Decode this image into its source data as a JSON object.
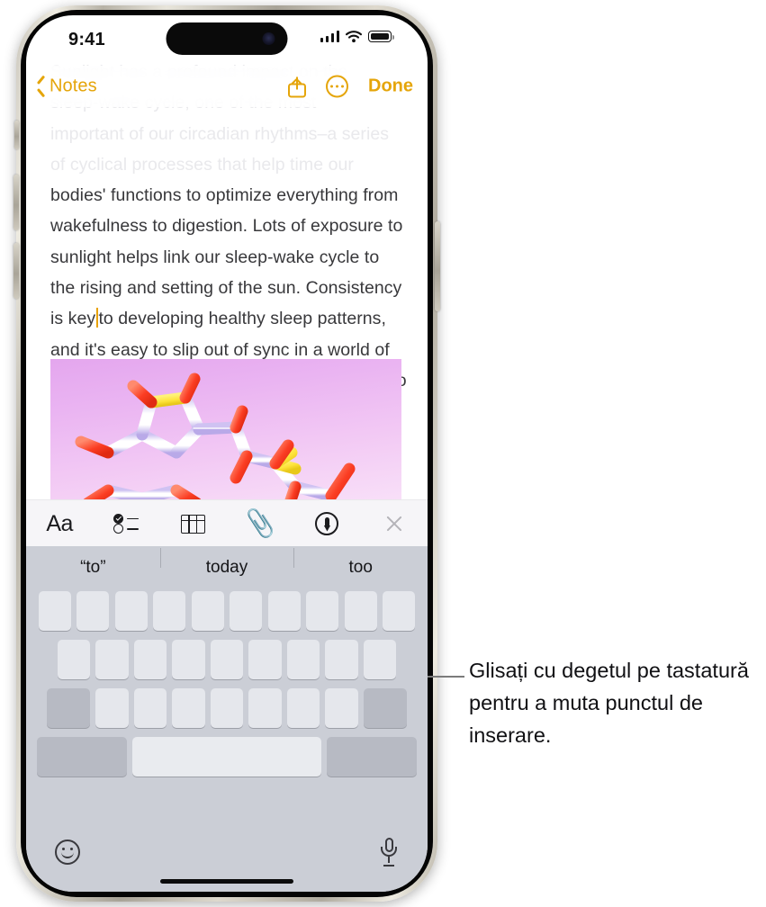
{
  "status_bar": {
    "time": "9:41",
    "signal_icon": "cellular-signal-icon",
    "wifi_icon": "wifi-icon",
    "battery_icon": "battery-icon"
  },
  "nav_bar": {
    "back_label": "Notes",
    "back_icon": "chevron-left-icon",
    "share_icon": "share-icon",
    "more_icon": "more-ellipsis-icon",
    "done_label": "Done"
  },
  "note": {
    "faded_lines": [
      "Sunlight has a profound impact on the",
      "sleep-wake cycle, one of the most",
      "important of our circadian rhythms–a series",
      "of cyclical processes that help time our"
    ],
    "visible_before_caret": "bodies' functions to optimize everything from wakefulness to digestion. Lots of exposure to sunlight helps link our sleep-wake cycle to the rising and setting of the sun. Consistency is key",
    "visible_after_caret": "to developing healthy sleep patterns, and it's easy to slip out of sync in a world of constant connection, where many are used to working across multiple timezones.",
    "attachment_name": "molecule-image-attachment"
  },
  "format_toolbar": {
    "items": [
      {
        "label": "Aa",
        "icon": "text-format-icon"
      },
      {
        "label": "",
        "icon": "checklist-icon"
      },
      {
        "label": "",
        "icon": "table-icon"
      },
      {
        "label": "",
        "icon": "paperclip-attachment-icon"
      },
      {
        "label": "",
        "icon": "markup-pen-icon"
      },
      {
        "label": "",
        "icon": "close-x-icon"
      }
    ]
  },
  "keyboard": {
    "predictions": [
      "“to”",
      "today",
      "too"
    ],
    "emoji_icon": "emoji-smiley-icon",
    "dictation_icon": "microphone-icon",
    "row1_keys": 10,
    "row2_keys": 9,
    "row3_keys": 9,
    "row4_fn_label": "",
    "row4_space_label": "",
    "row4_return_label": ""
  },
  "callout": {
    "text": "Glisați cu degetul pe tastatură pentru a muta punctul de inserare."
  },
  "colors": {
    "accent": "#E5A50A",
    "caret": "#E8A200",
    "keyboard_bg": "#CBCED6",
    "key_face": "#E5E7EC",
    "key_dark": "#B7BAC3",
    "toolbar_bg": "#F6F5F8",
    "text": "#38383b"
  }
}
